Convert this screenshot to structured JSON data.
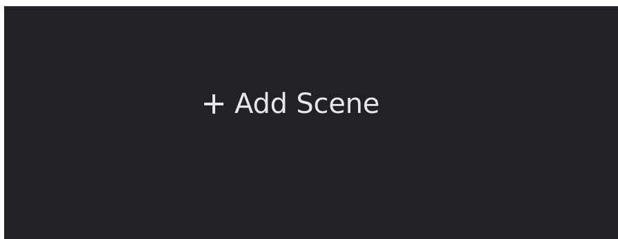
{
  "panel": {
    "add_scene": {
      "icon": "plus-icon",
      "label": "Add Scene"
    }
  },
  "colors": {
    "panel_background": "#212226",
    "text": "#e7e7ea"
  }
}
